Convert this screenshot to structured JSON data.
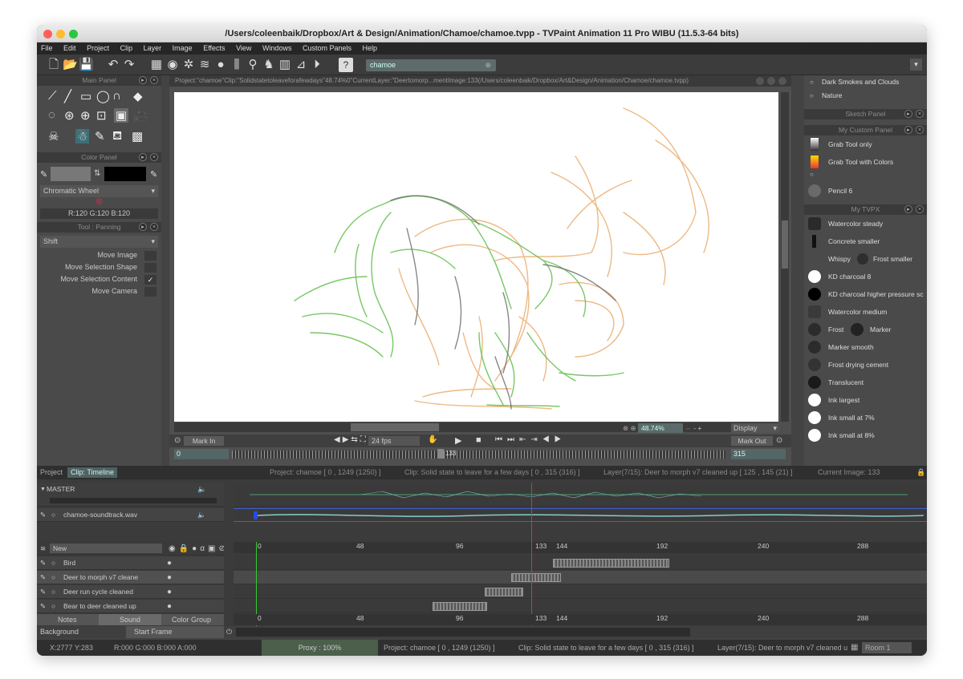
{
  "title": "/Users/coleenbaik/Dropbox/Art & Design/Animation/Chamoe/chamoe.tvpp - TVPaint Animation 11 Pro WIBU (11.5.3-64 bits)",
  "menu": [
    "File",
    "Edit",
    "Project",
    "Clip",
    "Layer",
    "Image",
    "Effects",
    "View",
    "Windows",
    "Custom Panels",
    "Help"
  ],
  "search": "chamoe",
  "main_panel": {
    "title": "Main Panel"
  },
  "color_panel": {
    "title": "Color Panel",
    "wheel": "Chromatic Wheel",
    "rgb": "R:120 G:120 B:120"
  },
  "tool_panel": {
    "title": "Tool : Panning",
    "mode": "Shift",
    "options": [
      "Move Image",
      "Move Selection Shape",
      "Move Selection Content",
      "Move Camera"
    ],
    "check": "✓"
  },
  "canvas": {
    "header": "Project:\"chamoe\"Clip:\"Solidstatetoleaveforafewdays\"48.74%0\"CurrentLayer:\"Deertomorp...mentImage:133(/Users/coleenbaik/Dropbox/Art&Design/Animation/Chamoe/chamoe.tvpp)",
    "zoom": "48.74%",
    "display": "Display",
    "mark_in": "Mark In",
    "mark_out": "Mark Out",
    "fps": "24 fps",
    "frame_in": "0",
    "frame_out": "315",
    "cur_frame": "133"
  },
  "right_panel": {
    "top_items": [
      "Dark Smokes and Clouds",
      "Nature"
    ],
    "sketch": "Sketch Panel",
    "custom": "My Custom Panel",
    "custom_items": [
      "Grab Tool only",
      "Grab Tool with Colors",
      "Pencil 6"
    ],
    "tvpx": "My TVPX",
    "brushes": [
      "Watercolor steady",
      "Concrete smaller",
      "Whispy",
      "Frost smaller",
      "KD charcoal 8",
      "KD charcoal higher pressure sc",
      "Watercolor medium",
      "Frost",
      "Marker",
      "Marker smooth",
      "Frost drying cement",
      "Translucent",
      "Ink largest",
      "Ink small at 7%",
      "Ink small at 8%"
    ]
  },
  "timeline": {
    "tabs": [
      "Project",
      "Clip: Timeline"
    ],
    "info": [
      "Project: chamoe [ 0 , 1249  (1250) ]",
      "Clip: Solid state to leave for a few days [ 0 , 315  (316) ]",
      "Layer(7/15): Deer to morph v7 cleaned up [ 125 , 145  (21) ]",
      "Current Image: 133"
    ],
    "master": "MASTER",
    "sound": "chamoe-soundtrack.wav",
    "new": "New",
    "layers": [
      "Bird",
      "Deer to morph v7 cleane",
      "Deer run cycle cleaned",
      "Bear to deer cleaned up"
    ],
    "bottom_tabs": [
      "Notes",
      "Sound",
      "Color Group"
    ],
    "background": "Background",
    "start_frame": "Start Frame",
    "ticks": [
      "0",
      "48",
      "96",
      "133",
      "144",
      "192",
      "240",
      "288"
    ]
  },
  "status": {
    "coords": "X:2777  Y:283",
    "rgba": "R:000 G:000 B:000 A:000",
    "proxy": "Proxy : 100%",
    "project": "Project: chamoe [ 0 , 1249  (1250) ]",
    "clip": "Clip: Solid state to leave for a few days [ 0 , 315  (316) ]",
    "layer": "Layer(7/15): Deer to morph v7 cleaned u",
    "room": "Room 1"
  }
}
